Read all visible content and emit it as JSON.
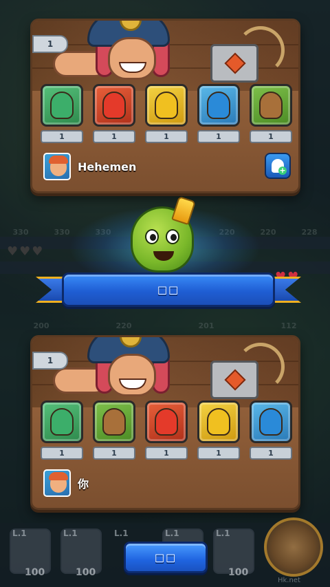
{
  "top_panel": {
    "hero_level": "1",
    "slots": [
      {
        "unit": "hood-green",
        "color": "#3cae6a",
        "level": "1"
      },
      {
        "unit": "hood-red",
        "color": "#e43a2a",
        "level": "1"
      },
      {
        "unit": "hat-yellow",
        "color": "#f0c020",
        "level": "1"
      },
      {
        "unit": "hat-blue",
        "color": "#2a8ad8",
        "level": "1"
      },
      {
        "unit": "tree",
        "color": "#7ec04a",
        "level": "1"
      }
    ],
    "player_name": "Hehemen"
  },
  "bottom_panel": {
    "hero_level": "1",
    "slots": [
      {
        "unit": "hood-green",
        "color": "#3cae6a",
        "level": "1"
      },
      {
        "unit": "tree",
        "color": "#7ec04a",
        "level": "1"
      },
      {
        "unit": "hood-red",
        "color": "#e43a2a",
        "level": "1"
      },
      {
        "unit": "hat-yellow",
        "color": "#f0c020",
        "level": "1"
      },
      {
        "unit": "hat-blue",
        "color": "#2a8ad8",
        "level": "1"
      }
    ],
    "player_name": "你"
  },
  "banner": {
    "label": "□□"
  },
  "ok_button": {
    "label": "□□"
  },
  "background": {
    "numbers_top": [
      "330",
      "330",
      "330",
      "330",
      "220",
      "220",
      "220",
      "228"
    ],
    "numbers_mid": [
      "200",
      "220",
      "201",
      "112"
    ],
    "deck_levels": [
      "L.1",
      "L.1",
      "L.1",
      "L.1",
      "L.1"
    ],
    "deck_costs": [
      "100",
      "100",
      "100",
      "100"
    ]
  },
  "watermark": "Hk.net"
}
